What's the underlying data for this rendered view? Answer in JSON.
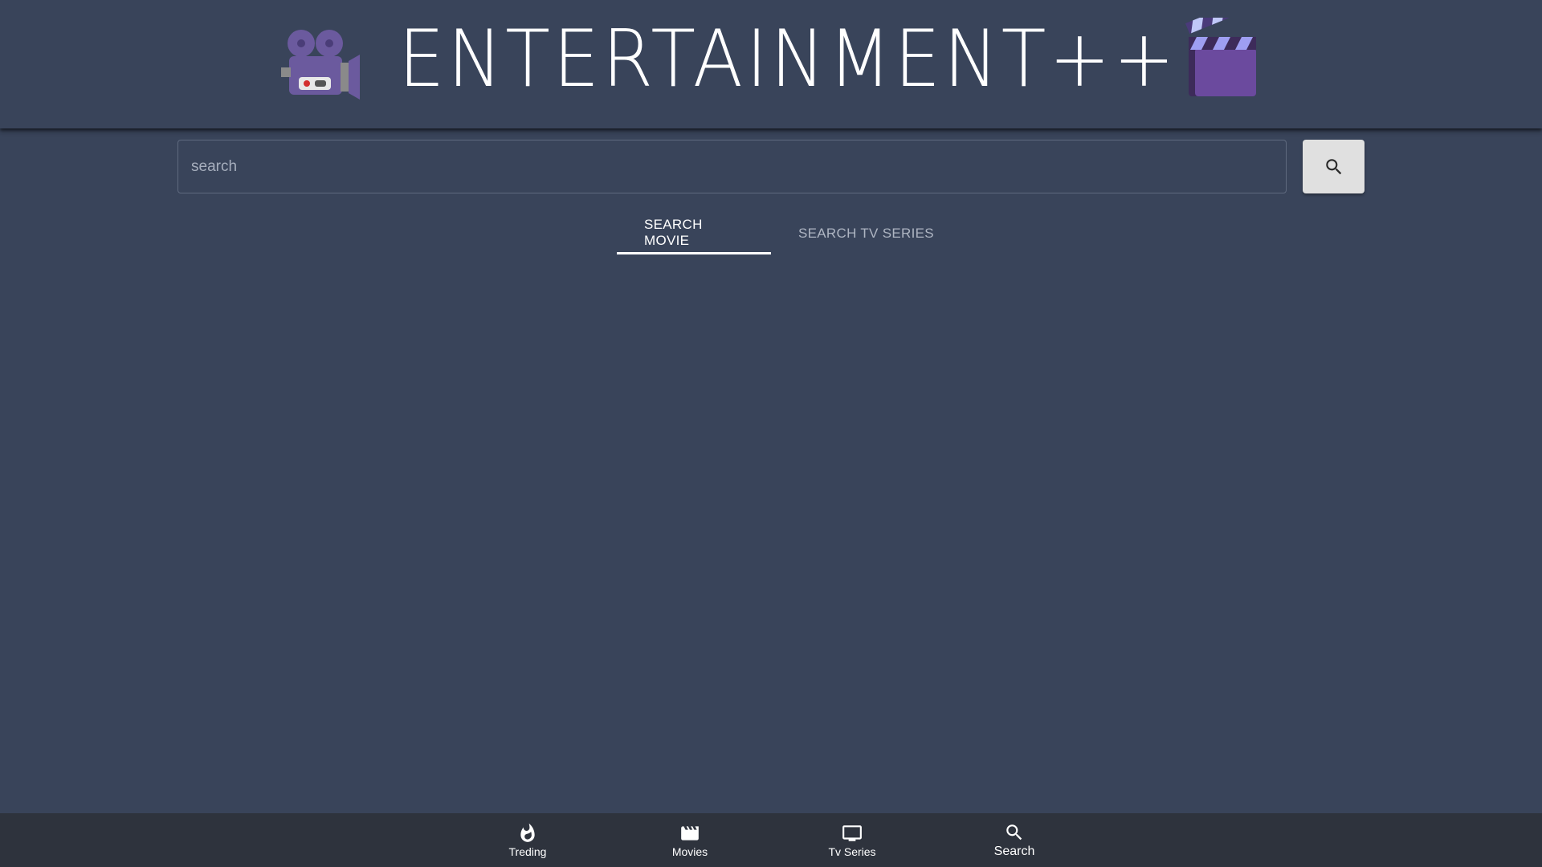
{
  "header": {
    "title": "ENTERTAINMENT++",
    "left_icon": "movie-camera-icon",
    "right_icon": "clapper-board-icon",
    "icon_color": "#6b5a9e"
  },
  "search": {
    "placeholder": "search",
    "value": "",
    "button_icon": "search-icon"
  },
  "tabs": [
    {
      "label": "SEARCH MOVIE",
      "active": true
    },
    {
      "label": "SEARCH TV SERIES",
      "active": false
    }
  ],
  "bottom_nav": {
    "items": [
      {
        "label": "Treding",
        "icon": "whatshot-icon",
        "active": false
      },
      {
        "label": "Movies",
        "icon": "movie-icon",
        "active": false
      },
      {
        "label": "Tv Series",
        "icon": "tv-icon",
        "active": false
      },
      {
        "label": "Search",
        "icon": "search-icon",
        "active": true
      }
    ]
  },
  "colors": {
    "background": "#39445a",
    "bottom_nav": "#2e333d",
    "button": "#e0e0e0"
  }
}
